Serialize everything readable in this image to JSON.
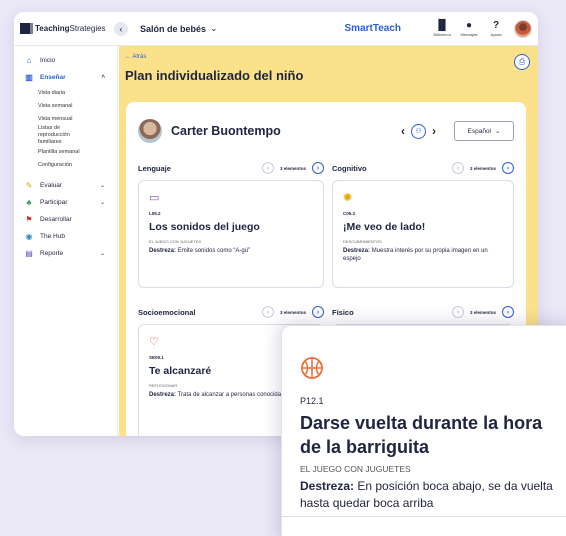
{
  "topbar": {
    "logo_bold": "Teaching",
    "logo_light": "Strategies",
    "classroom": "Salón de bebés",
    "brand": "SmartTeach",
    "icons": [
      {
        "name": "library-icon",
        "label": "Biblioteca"
      },
      {
        "name": "messages-icon",
        "label": "Mensajes"
      },
      {
        "name": "help-icon",
        "label": "Ayuda"
      }
    ]
  },
  "sidebar": {
    "items": [
      {
        "label": "Inicio",
        "icon": "home-icon"
      },
      {
        "label": "Enseñar",
        "icon": "book-icon"
      },
      {
        "label": "Evaluar",
        "icon": "evaluate-icon"
      },
      {
        "label": "Participar",
        "icon": "family-icon"
      },
      {
        "label": "Desarrollar",
        "icon": "develop-icon"
      },
      {
        "label": "The Hub",
        "icon": "hub-icon"
      },
      {
        "label": "Reporte",
        "icon": "report-icon"
      }
    ],
    "subitems": [
      "Vista diaria",
      "Vista semanal",
      "Vista mensual",
      "Listas de reproducción familiares",
      "Plantilla semanal",
      "Configuración"
    ]
  },
  "main": {
    "back": "← Atrás",
    "title": "Plan individualizado del niño",
    "child_name": "Carter Buontempo",
    "language": "Español"
  },
  "domains": [
    {
      "name": "Lenguaje",
      "count": "3 elementos",
      "card": {
        "code": "L09.2",
        "title": "Los sonidos del juego",
        "category": "EL JUEGO CON JUGUETES",
        "skill_label": "Destreza:",
        "skill": "Emite sonidos como “A-gú”"
      }
    },
    {
      "name": "Cognitivo",
      "count": "3 elementos",
      "card": {
        "code": "C05.3",
        "title": "¡Me veo de lado!",
        "category": "DESCUBRIMIENTOS",
        "skill_label": "Destreza:",
        "skill": "Muestra interés por su propia imagen en un espejo"
      }
    },
    {
      "name": "Socioemocional",
      "count": "3 elementos",
      "card": {
        "code": "SE09.1",
        "title": "Te alcanzaré",
        "category": "REFLEXIONAR",
        "skill_label": "Destreza:",
        "skill": "Trata de alcanzar a personas conocidas"
      }
    },
    {
      "name": "Físico",
      "count": "3 elementos"
    }
  ],
  "zoom_card": {
    "code": "P12.1",
    "title": "Darse vuelta durante la hora de la barriguita",
    "category": "EL JUEGO CON JUGUETES",
    "skill_label": "Destreza:",
    "skill": "En posición boca abajo, se da vuelta hasta quedar boca arriba"
  },
  "colors": {
    "accent": "#2c5fd4",
    "main_bg": "#fbe28a",
    "page_bg": "#ebe8f7",
    "ball": "#e8703a"
  }
}
